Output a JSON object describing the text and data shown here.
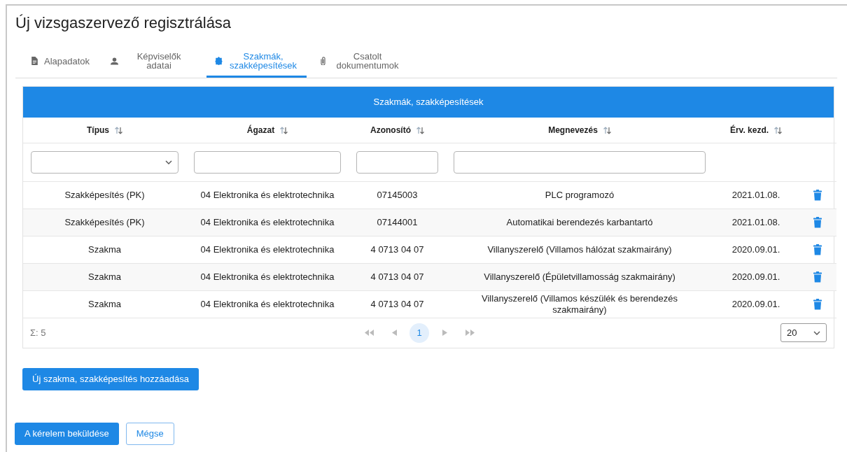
{
  "title": "Új vizsgaszervező regisztrálása",
  "tabs": [
    {
      "label": "Alapadatok",
      "kind": "document",
      "selected": false
    },
    {
      "label": "Képviselők adatai",
      "kind": "person",
      "selected": false
    },
    {
      "label": "Szakmák, szakképesítések",
      "kind": "badge",
      "selected": true
    },
    {
      "label": "Csatolt dokumentumok",
      "kind": "paperclip",
      "selected": false
    }
  ],
  "table": {
    "title": "Szakmák, szakképesítések",
    "columns": [
      {
        "label": "Típus",
        "kind": "select"
      },
      {
        "label": "Ágazat",
        "kind": "text"
      },
      {
        "label": "Azonosító",
        "kind": "text"
      },
      {
        "label": "Megnevezés",
        "kind": "text"
      },
      {
        "label": "Érv. kezd.",
        "kind": "plain"
      }
    ],
    "rows": [
      [
        "Szakképesítés (PK)",
        "04 Elektronika és elektrotechnika",
        "07145003",
        "PLC programozó",
        "2021.01.08."
      ],
      [
        "Szakképesítés (PK)",
        "04 Elektronika és elektrotechnika",
        "07144001",
        "Automatikai berendezés karbantartó",
        "2021.01.08."
      ],
      [
        "Szakma",
        "04 Elektronika és elektrotechnika",
        "4 0713 04 07",
        "Villanyszerelő (Villamos hálózat szakmairány)",
        "2020.09.01."
      ],
      [
        "Szakma",
        "04 Elektronika és elektrotechnika",
        "4 0713 04 07",
        "Villanyszerelő (Épületvillamosság szakmairány)",
        "2020.09.01."
      ],
      [
        "Szakma",
        "04 Elektronika és elektrotechnika",
        "4 0713 04 07",
        "Villanyszerelő (Villamos készülék és berendezés szakmairány)",
        "2020.09.01."
      ]
    ],
    "total": "Σ: 5",
    "pages": [
      {
        "label": "1",
        "selected": true
      }
    ],
    "page_size": "20"
  },
  "add_button": "Új szakma, szakképesítés hozzáadása",
  "submit_button": "A kérelem beküldése",
  "cancel_button": "Mégse"
}
